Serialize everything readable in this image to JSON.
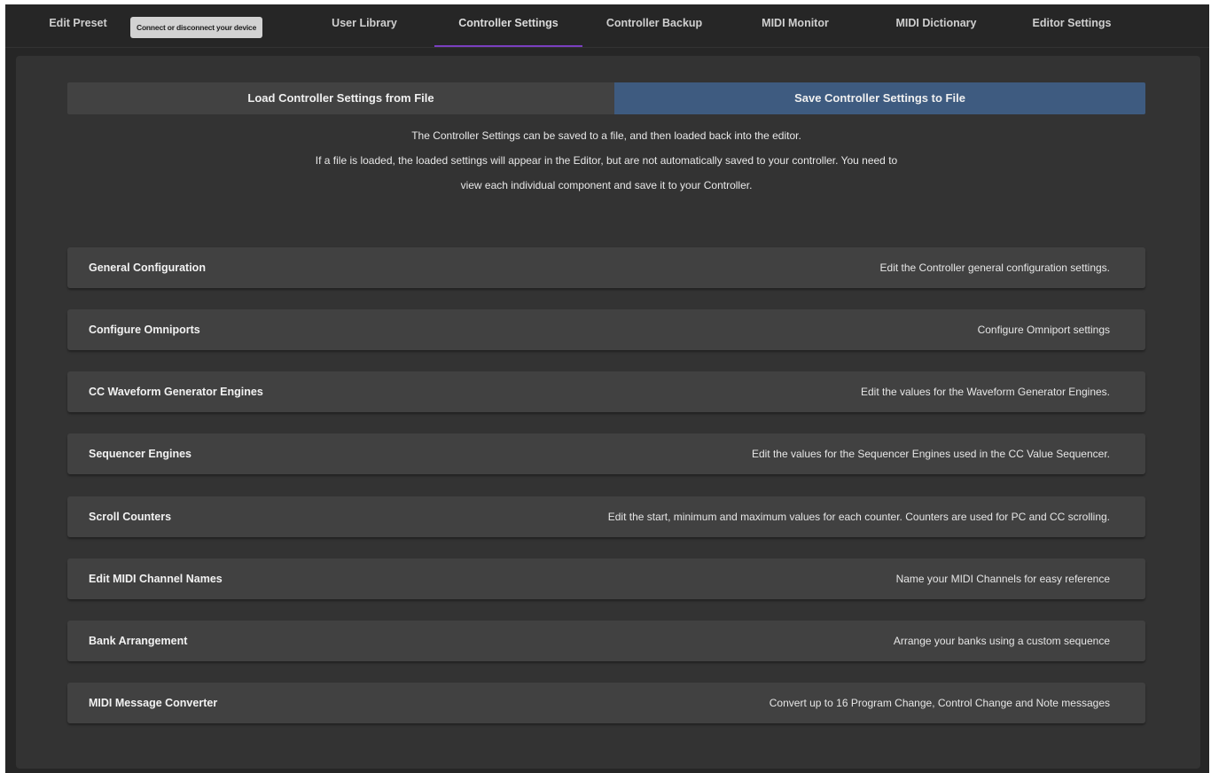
{
  "tabs": [
    {
      "label": "Edit Preset"
    },
    {
      "label": "User Library"
    },
    {
      "label": "Controller Settings",
      "active": true
    },
    {
      "label": "Controller Backup"
    },
    {
      "label": "MIDI Monitor"
    },
    {
      "label": "MIDI Dictionary"
    },
    {
      "label": "Editor Settings"
    }
  ],
  "tooltip": "Connect or disconnect your device",
  "file_buttons": {
    "load": "Load Controller Settings from File",
    "save": "Save Controller Settings to File"
  },
  "info_lines": [
    "The Controller Settings can be saved to a file, and then loaded back into the editor.",
    "If a file is loaded, the loaded settings will appear in the Editor, but are not automatically saved to your controller. You need to",
    "view each individual component and save it to your Controller."
  ],
  "settings": [
    {
      "label": "General Configuration",
      "desc": "Edit the Controller general configuration settings."
    },
    {
      "label": "Configure Omniports",
      "desc": "Configure Omniport settings"
    },
    {
      "label": "CC Waveform Generator Engines",
      "desc": "Edit the values for the Waveform Generator Engines."
    },
    {
      "label": "Sequencer Engines",
      "desc": "Edit the values for the Sequencer Engines used in the CC Value Sequencer."
    },
    {
      "label": "Scroll Counters",
      "desc": "Edit the start, minimum and maximum values for each counter. Counters are used for PC and CC scrolling."
    },
    {
      "label": "Edit MIDI Channel Names",
      "desc": "Name your MIDI Channels for easy reference"
    },
    {
      "label": "Bank Arrangement",
      "desc": "Arrange your banks using a custom sequence"
    },
    {
      "label": "MIDI Message Converter",
      "desc": "Convert up to 16 Program Change, Control Change and Note messages"
    }
  ],
  "colors": {
    "background": "#262626",
    "panel": "#333333",
    "row": "#414141",
    "save_button": "#3e5b80",
    "load_button": "#424242",
    "active_tab_underline": "#7a3fbf"
  }
}
